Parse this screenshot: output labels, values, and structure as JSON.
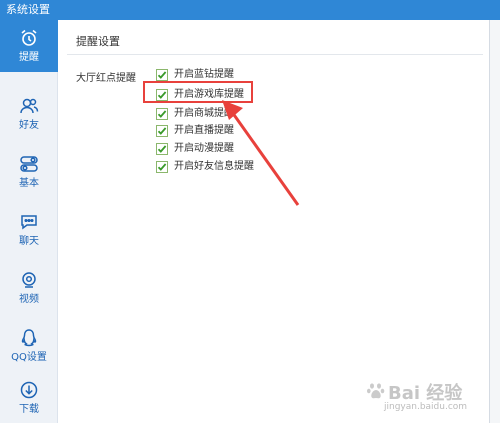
{
  "window": {
    "title": "系统设置"
  },
  "sidebar": {
    "items": [
      {
        "id": "remind",
        "label": "提醒",
        "icon": "alarm-clock-icon",
        "active": true
      },
      {
        "id": "friends",
        "label": "好友",
        "icon": "friends-icon",
        "active": false
      },
      {
        "id": "basic",
        "label": "基本",
        "icon": "toggle-switches-icon",
        "active": false
      },
      {
        "id": "chat",
        "label": "聊天",
        "icon": "chat-bubble-icon",
        "active": false
      },
      {
        "id": "video",
        "label": "视频",
        "icon": "webcam-icon",
        "active": false
      },
      {
        "id": "qq",
        "label": "QQ设置",
        "icon": "qq-penguin-icon",
        "active": false
      },
      {
        "id": "download",
        "label": "下载",
        "icon": "download-icon",
        "active": false
      }
    ]
  },
  "main": {
    "section_title": "提醒设置",
    "group_label": "大厅红点提醒",
    "options": [
      {
        "label": "开启蓝钻提醒",
        "checked": true
      },
      {
        "label": "开启游戏库提醒",
        "checked": true,
        "highlighted": true
      },
      {
        "label": "开启商城提醒",
        "checked": true
      },
      {
        "label": "开启直播提醒",
        "checked": true
      },
      {
        "label": "开启动漫提醒",
        "checked": true
      },
      {
        "label": "开启好友信息提醒",
        "checked": true
      }
    ]
  },
  "watermark": {
    "brand": "Bai 经验",
    "url": "jingyan.baidu.com"
  },
  "colors": {
    "accent": "#2f87d6",
    "checkbox": "#3a9a2a",
    "annotation": "#e8413c"
  }
}
